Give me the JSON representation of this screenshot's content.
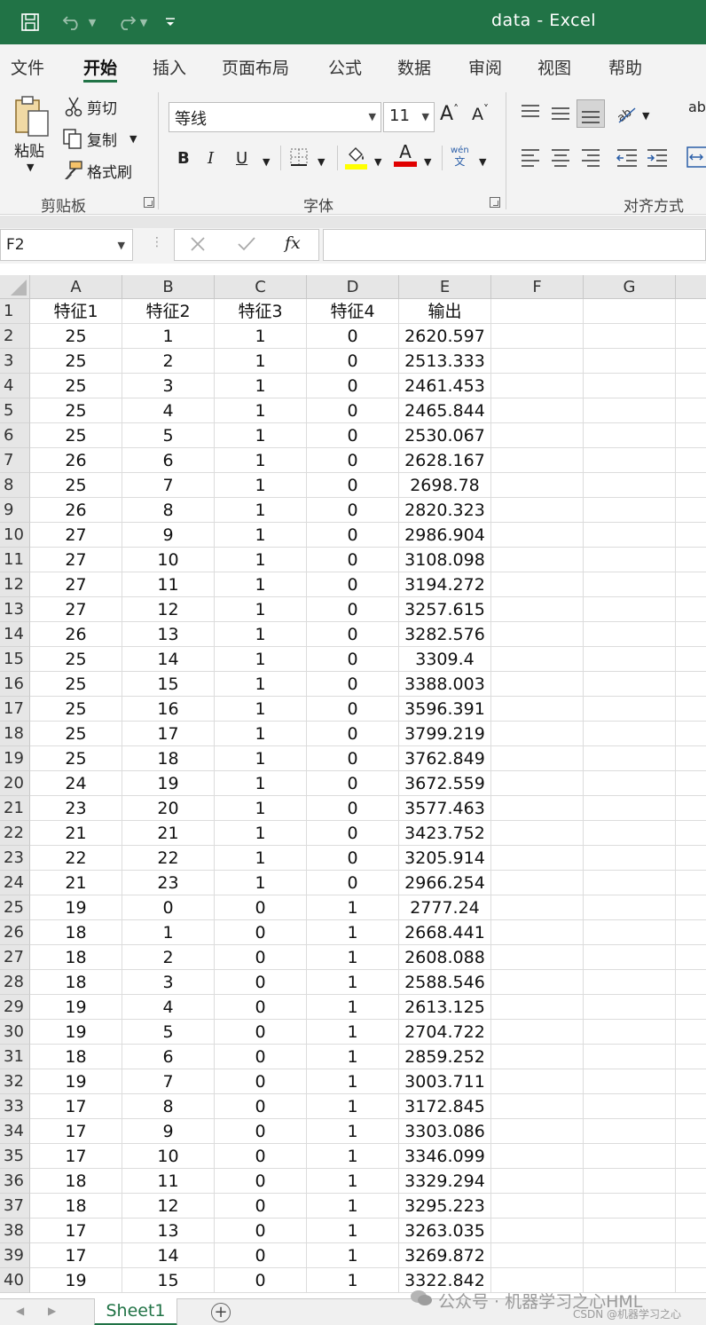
{
  "window": {
    "title": "data  -  Excel"
  },
  "tabs": [
    "文件",
    "开始",
    "插入",
    "页面布局",
    "公式",
    "数据",
    "审阅",
    "视图",
    "帮助"
  ],
  "ribbon": {
    "paste": "粘贴",
    "cut": "剪切",
    "copy": "复制",
    "format_painter": "格式刷",
    "clipboard_group": "剪贴板",
    "font_name": "等线",
    "font_size": "11",
    "grow_font": "A",
    "shrink_font": "A",
    "bold": "B",
    "italic": "I",
    "underline": "U",
    "font_color_glyph": "A",
    "wen_top": "wén",
    "wen_bottom": "文",
    "font_group": "字体",
    "align_group": "对齐方式",
    "wrap_partial": "ab"
  },
  "formula_bar": {
    "name_box": "F2",
    "fx": "fx",
    "formula": ""
  },
  "columns": [
    "A",
    "B",
    "C",
    "D",
    "E",
    "F",
    "G"
  ],
  "rows": [
    [
      "特征1",
      "特征2",
      "特征3",
      "特征4",
      "输出"
    ],
    [
      "25",
      "1",
      "1",
      "0",
      "2620.597"
    ],
    [
      "25",
      "2",
      "1",
      "0",
      "2513.333"
    ],
    [
      "25",
      "3",
      "1",
      "0",
      "2461.453"
    ],
    [
      "25",
      "4",
      "1",
      "0",
      "2465.844"
    ],
    [
      "25",
      "5",
      "1",
      "0",
      "2530.067"
    ],
    [
      "26",
      "6",
      "1",
      "0",
      "2628.167"
    ],
    [
      "25",
      "7",
      "1",
      "0",
      "2698.78"
    ],
    [
      "26",
      "8",
      "1",
      "0",
      "2820.323"
    ],
    [
      "27",
      "9",
      "1",
      "0",
      "2986.904"
    ],
    [
      "27",
      "10",
      "1",
      "0",
      "3108.098"
    ],
    [
      "27",
      "11",
      "1",
      "0",
      "3194.272"
    ],
    [
      "27",
      "12",
      "1",
      "0",
      "3257.615"
    ],
    [
      "26",
      "13",
      "1",
      "0",
      "3282.576"
    ],
    [
      "25",
      "14",
      "1",
      "0",
      "3309.4"
    ],
    [
      "25",
      "15",
      "1",
      "0",
      "3388.003"
    ],
    [
      "25",
      "16",
      "1",
      "0",
      "3596.391"
    ],
    [
      "25",
      "17",
      "1",
      "0",
      "3799.219"
    ],
    [
      "25",
      "18",
      "1",
      "0",
      "3762.849"
    ],
    [
      "24",
      "19",
      "1",
      "0",
      "3672.559"
    ],
    [
      "23",
      "20",
      "1",
      "0",
      "3577.463"
    ],
    [
      "21",
      "21",
      "1",
      "0",
      "3423.752"
    ],
    [
      "22",
      "22",
      "1",
      "0",
      "3205.914"
    ],
    [
      "21",
      "23",
      "1",
      "0",
      "2966.254"
    ],
    [
      "19",
      "0",
      "0",
      "1",
      "2777.24"
    ],
    [
      "18",
      "1",
      "0",
      "1",
      "2668.441"
    ],
    [
      "18",
      "2",
      "0",
      "1",
      "2608.088"
    ],
    [
      "18",
      "3",
      "0",
      "1",
      "2588.546"
    ],
    [
      "19",
      "4",
      "0",
      "1",
      "2613.125"
    ],
    [
      "19",
      "5",
      "0",
      "1",
      "2704.722"
    ],
    [
      "18",
      "6",
      "0",
      "1",
      "2859.252"
    ],
    [
      "19",
      "7",
      "0",
      "1",
      "3003.711"
    ],
    [
      "17",
      "8",
      "0",
      "1",
      "3172.845"
    ],
    [
      "17",
      "9",
      "0",
      "1",
      "3303.086"
    ],
    [
      "17",
      "10",
      "0",
      "1",
      "3346.099"
    ],
    [
      "18",
      "11",
      "0",
      "1",
      "3329.294"
    ],
    [
      "18",
      "12",
      "0",
      "1",
      "3295.223"
    ],
    [
      "17",
      "13",
      "0",
      "1",
      "3263.035"
    ],
    [
      "17",
      "14",
      "0",
      "1",
      "3269.872"
    ],
    [
      "19",
      "15",
      "0",
      "1",
      "3322.842"
    ]
  ],
  "sheets": [
    "Sheet1"
  ],
  "add_sheet": "+",
  "watermark": {
    "line1": "公众号 · 机器学习之心HML",
    "line2": "CSDN @机器学习之心"
  },
  "colors": {
    "brand": "#217346",
    "highlight": "#ffff00",
    "font_color": "#e00000"
  }
}
